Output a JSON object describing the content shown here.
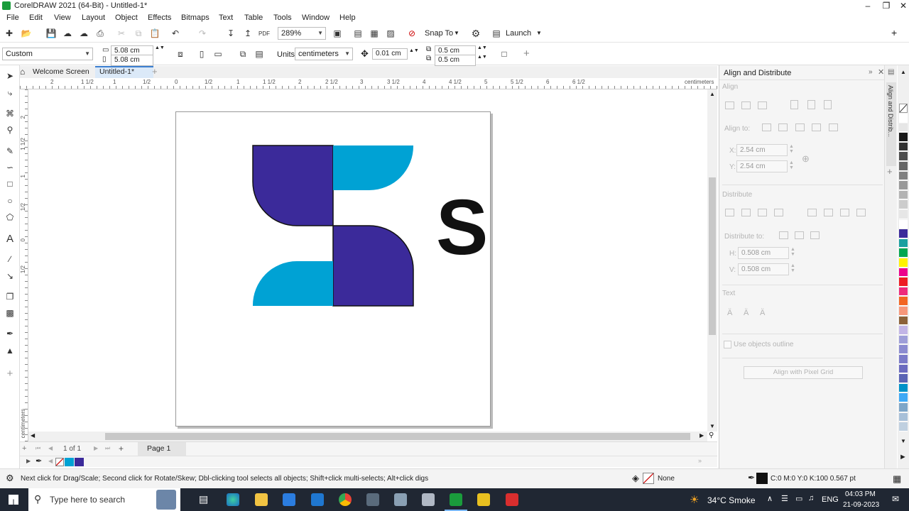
{
  "window": {
    "title": "CorelDRAW 2021 (64-Bit) - Untitled-1*"
  },
  "menu": [
    "File",
    "Edit",
    "View",
    "Layout",
    "Object",
    "Effects",
    "Bitmaps",
    "Text",
    "Table",
    "Tools",
    "Window",
    "Help"
  ],
  "toolbar": {
    "zoom": "289%",
    "snap": "Snap To",
    "launch": "Launch"
  },
  "property_bar": {
    "preset": "Custom",
    "width": "5.08 cm",
    "height": "5.08 cm",
    "units_label": "Units:",
    "units": "centimeters",
    "nudge": "0.01 cm",
    "dup_x": "0.5 cm",
    "dup_y": "0.5 cm"
  },
  "tabs": {
    "welcome": "Welcome Screen",
    "doc": "Untitled-1*"
  },
  "ruler": {
    "h": [
      "2",
      "1 1/2",
      "1",
      "1/2",
      "0",
      "1/2",
      "1",
      "1 1/2",
      "2",
      "2 1/2",
      "3",
      "3 1/2",
      "4",
      "4 1/2",
      "5",
      "5 1/2",
      "6",
      "6 1/2",
      "centimeters"
    ],
    "v": [
      "2",
      "1 1/2",
      "1",
      "1/2",
      "0",
      "1/2",
      "centimeters"
    ]
  },
  "artwork": {
    "letter": "S",
    "colors": {
      "purple": "#3b2a9a",
      "cyan": "#00a2d4",
      "black": "#111111"
    }
  },
  "page_nav": {
    "count": "1 of 1",
    "page": "Page 1"
  },
  "panel": {
    "title": "Align and Distribute",
    "align": "Align",
    "align_to": "Align to:",
    "x_label": "X:",
    "x": "2.54 cm",
    "y_label": "Y:",
    "y": "2.54 cm",
    "distribute": "Distribute",
    "distribute_to": "Distribute to:",
    "h_label": "H:",
    "h": "0.508 cm",
    "v_label": "V:",
    "v": "0.508 cm",
    "text": "Text",
    "outline": "Use objects outline",
    "pixel_grid": "Align with Pixel Grid"
  },
  "docker_tab": "Align and Distrib...",
  "status": {
    "hint": "Next click for Drag/Scale; Second click for Rotate/Skew; Dbl-clicking tool selects all objects; Shift+click multi-selects; Alt+click digs",
    "fill": "None",
    "outline": "C:0 M:0 Y:0 K:100  0.567 pt"
  },
  "taskbar": {
    "search": "Type here to search",
    "weather": "34°C  Smoke",
    "lang": "ENG",
    "time": "04:03 PM",
    "date": "21-09-2023"
  },
  "palette": [
    "#ffffff",
    "#e6e6e6",
    "#1a1a1a",
    "#333333",
    "#4d4d4d",
    "#666666",
    "#808080",
    "#999999",
    "#b3b3b3",
    "#cccccc",
    "#e6e6e6",
    "#ffffff",
    "#3b2a9a",
    "#1aa0a0",
    "#00a651",
    "#fff200",
    "#ec008c",
    "#ed1c24",
    "#ee2a7b",
    "#f26522",
    "#f7977a",
    "#8c6239",
    "#c2b5e6",
    "#9e9ed8",
    "#8b8bd0",
    "#7a7ac8",
    "#6b6bbf",
    "#5a64b4",
    "#0092c8",
    "#3fa9f5",
    "#7ea6c8",
    "#a8c0d8",
    "#c0d0e0"
  ]
}
